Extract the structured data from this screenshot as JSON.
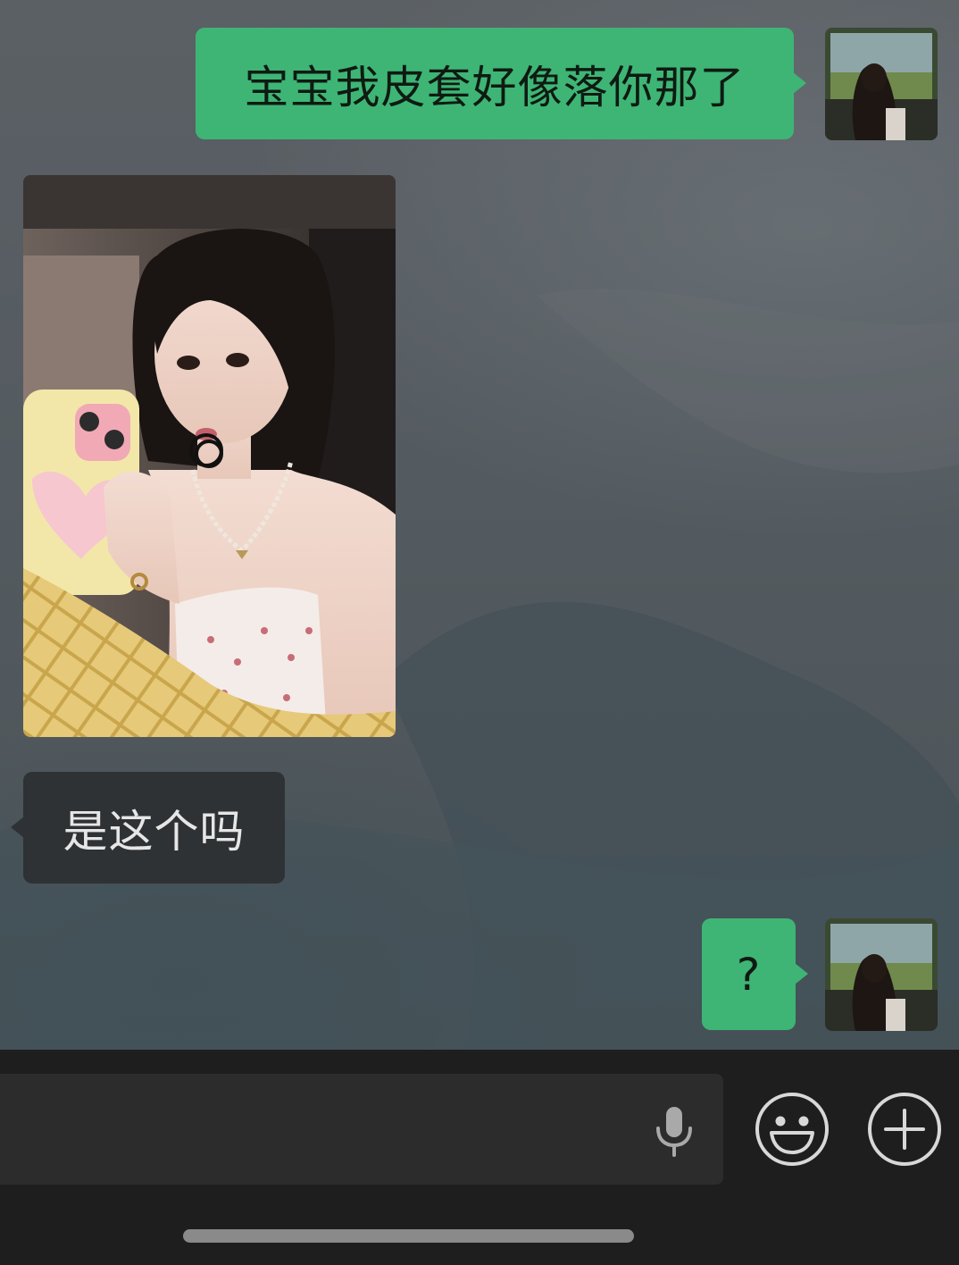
{
  "messages": [
    {
      "side": "outgoing",
      "type": "text",
      "text": "宝宝我皮套好像落你那了"
    },
    {
      "side": "incoming",
      "type": "image",
      "icon": "selfie-photo"
    },
    {
      "side": "incoming",
      "type": "text",
      "text": "是这个吗"
    },
    {
      "side": "outgoing",
      "type": "text",
      "text": "?"
    }
  ],
  "input_bar": {
    "placeholder": "",
    "icons": [
      "microphone-icon",
      "emoji-icon",
      "plus-icon"
    ]
  },
  "colors": {
    "outgoing_bubble": "#3eb575",
    "incoming_bubble": "#2f3234",
    "input_bar": "#1e1e1e"
  }
}
